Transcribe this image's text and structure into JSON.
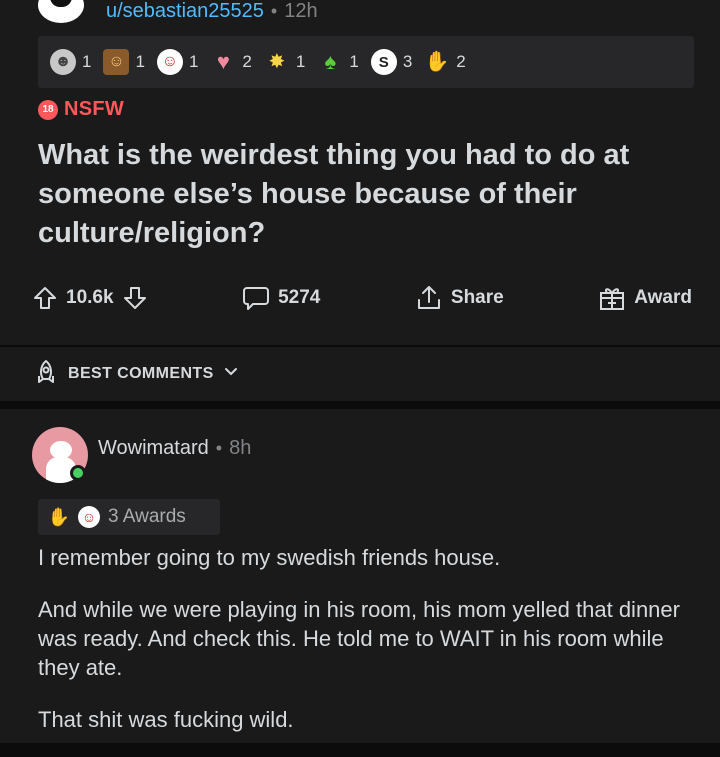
{
  "post": {
    "username": "u/sebastian25525",
    "separator": "•",
    "age": "12h",
    "awards": [
      {
        "icon": "silver-award-icon",
        "count": "1"
      },
      {
        "icon": "wholesome-award-icon",
        "count": "1"
      },
      {
        "icon": "helpful-award-icon",
        "count": "1"
      },
      {
        "icon": "heart-award-icon",
        "count": "2"
      },
      {
        "icon": "party-award-icon",
        "count": "1"
      },
      {
        "icon": "green-award-icon",
        "count": "1"
      },
      {
        "icon": "s-award-icon",
        "count": "3"
      },
      {
        "icon": "hands-award-icon",
        "count": "2"
      }
    ],
    "nsfw_badge": "18",
    "nsfw_label": "NSFW",
    "title": "What is the weirdest thing you had to do at someone else’s house because of their culture/religion?",
    "votes": "10.6k",
    "comments_count": "5274",
    "share_label": "Share",
    "award_label": "Award"
  },
  "sort": {
    "label": "BEST COMMENTS"
  },
  "comment": {
    "username": "Wowimatard",
    "separator": "•",
    "age": "8h",
    "awards_label": "3 Awards",
    "paragraphs": [
      "I remember going to my swedish friends house.",
      "And while we were playing in his room, his mom yelled that dinner was ready. And check this. He told me to WAIT in his room while they ate.",
      "That shit was fucking wild."
    ]
  },
  "colors": {
    "background": "#0c0c0d",
    "card": "#1a1a1b",
    "link_blue": "#4fbcff",
    "nsfw_red": "#ff585b",
    "online_green": "#46d160"
  }
}
